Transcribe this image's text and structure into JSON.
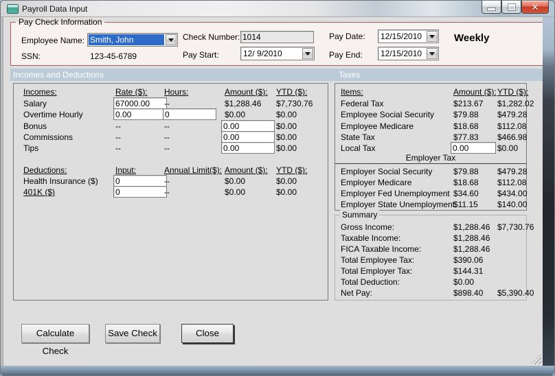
{
  "window": {
    "title": "Payroll Data Input",
    "close_glyph": "✕"
  },
  "paycheck_info": {
    "group_label": "Pay Check Information",
    "employee_name_label": "Employee Name:",
    "employee_name_value": "Smith, John",
    "ssn_label": "SSN:",
    "ssn_value": "123-45-6789",
    "check_number_label": "Check Number:",
    "check_number_value": "1014",
    "pay_start_label": "Pay Start:",
    "pay_start_value": "12/ 9/2010",
    "pay_date_label": "Pay Date:",
    "pay_date_value": "12/15/2010",
    "pay_end_label": "Pay End:",
    "pay_end_value": "12/15/2010",
    "pay_frequency": "Weekly"
  },
  "section_headers": {
    "left": "Incomes and Deductions",
    "right": "Taxes"
  },
  "incomes": {
    "col_headers": [
      "Incomes:",
      "Rate ($):",
      "Hours:",
      "Amount ($):",
      "YTD ($):"
    ],
    "salary": {
      "label": "Salary",
      "rate": "67000.00",
      "hours": "--",
      "amount": "$1,288.46",
      "ytd": "$7,730.76"
    },
    "overtime": {
      "label": "Overtime Hourly",
      "rate": "0.00",
      "hours": "0",
      "amount": "$0.00",
      "ytd": "$0.00"
    },
    "bonus": {
      "label": "Bonus",
      "rate": "--",
      "hours": "--",
      "amount": "0.00",
      "ytd": "$0.00"
    },
    "commissions": {
      "label": "Commissions",
      "rate": "--",
      "hours": "--",
      "amount": "0.00",
      "ytd": "$0.00"
    },
    "tips": {
      "label": "Tips",
      "rate": "--",
      "hours": "--",
      "amount": "0.00",
      "ytd": "$0.00"
    }
  },
  "deductions": {
    "col_headers": [
      "Deductions:",
      "Input:",
      "Annual Limit($):",
      "Amount ($):",
      "YTD ($):"
    ],
    "health_insurance": {
      "label": "Health Insurance  ($)",
      "input": "0",
      "annual_limit": "--",
      "amount": "$0.00",
      "ytd": "$0.00"
    },
    "k401": {
      "label": "401K  ($)",
      "input": "0",
      "annual_limit": "--",
      "amount": "$0.00",
      "ytd": "$0.00"
    }
  },
  "taxes": {
    "col_headers": [
      "Items:",
      "Amount ($):",
      "YTD ($):"
    ],
    "employee_rows": [
      {
        "label": "Federal Tax",
        "amount": "$213.67",
        "ytd": "$1,282.02"
      },
      {
        "label": "Employee Social Security",
        "amount": "$79.88",
        "ytd": "$479.28"
      },
      {
        "label": "Employee Medicare",
        "amount": "$18.68",
        "ytd": "$112.08"
      },
      {
        "label": "State Tax",
        "amount": "$77.83",
        "ytd": "$466.98"
      }
    ],
    "local_tax": {
      "label": "Local Tax",
      "amount_input": "0.00",
      "ytd": "$0.00"
    },
    "employer_section_label": "Employer Tax",
    "employer_rows": [
      {
        "label": "Employer Social Security",
        "amount": "$79.88",
        "ytd": "$479.28"
      },
      {
        "label": "Employer Medicare",
        "amount": "$18.68",
        "ytd": "$112.08"
      },
      {
        "label": "Employer Fed Unemployment",
        "amount": "$34.60",
        "ytd": "$434.00"
      },
      {
        "label": "Employer State Unemployment",
        "amount": "$11.15",
        "ytd": "$140.00"
      }
    ]
  },
  "summary": {
    "group_label": "Summary",
    "rows": [
      {
        "label": "Gross Income:",
        "amount": "$1,288.46",
        "ytd": "$7,730.76"
      },
      {
        "label": "Taxable Income:",
        "amount": "$1,288.46",
        "ytd": ""
      },
      {
        "label": "FICA Taxable Income:",
        "amount": "$1,288.46",
        "ytd": ""
      },
      {
        "label": "Total Employee Tax:",
        "amount": "$390.06",
        "ytd": ""
      },
      {
        "label": "Total Employer Tax:",
        "amount": "$144.31",
        "ytd": ""
      },
      {
        "label": "Total Deduction:",
        "amount": "$0.00",
        "ytd": ""
      },
      {
        "label": "Net Pay:",
        "amount": "$898.40",
        "ytd": "$5,390.40"
      }
    ]
  },
  "buttons": {
    "calculate": "Calculate Check",
    "save": "Save Check",
    "close": "Close"
  },
  "colors": {
    "selection_blue": "#2e6bc8",
    "section_header_bg": "#bccbd8",
    "group_border_red": "#b0595e",
    "close_button_red": "#c33c24"
  }
}
